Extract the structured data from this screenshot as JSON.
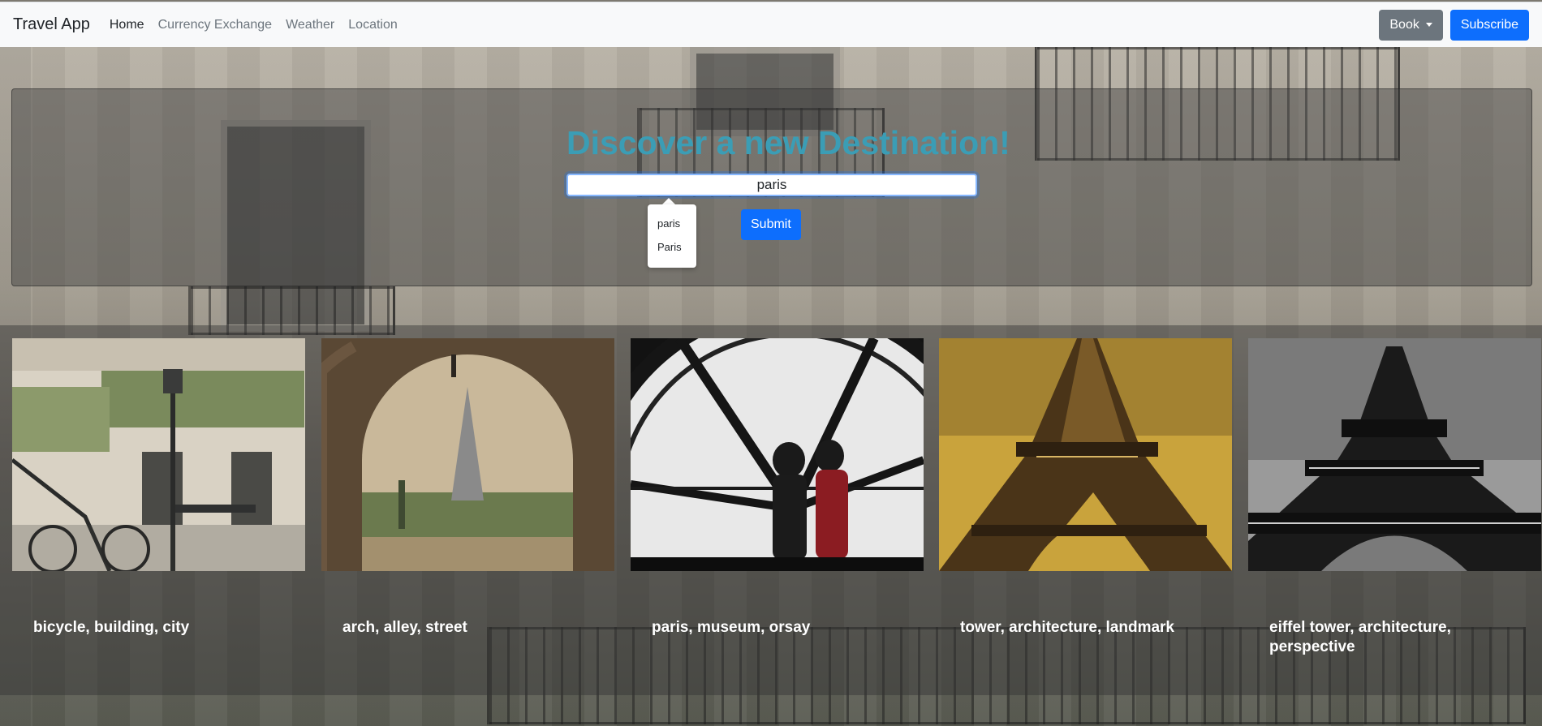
{
  "navbar": {
    "brand": "Travel App",
    "links": [
      "Home",
      "Currency Exchange",
      "Weather",
      "Location"
    ],
    "book_label": "Book",
    "subscribe_label": "Subscribe"
  },
  "hero": {
    "title": "Discover a new Destination!",
    "search_value": "paris",
    "suggestions": [
      "paris",
      "Paris"
    ],
    "submit_label": "Submit"
  },
  "gallery": {
    "cards": [
      {
        "caption": "bicycle, building, city"
      },
      {
        "caption": "arch, alley, street"
      },
      {
        "caption": "paris, museum, orsay"
      },
      {
        "caption": "tower, architecture, landmark"
      },
      {
        "caption": "eiffel tower, architecture, perspective"
      }
    ]
  },
  "colors": {
    "title": "#3b9db5",
    "primary": "#0d6efd",
    "secondary": "#6c757d"
  }
}
